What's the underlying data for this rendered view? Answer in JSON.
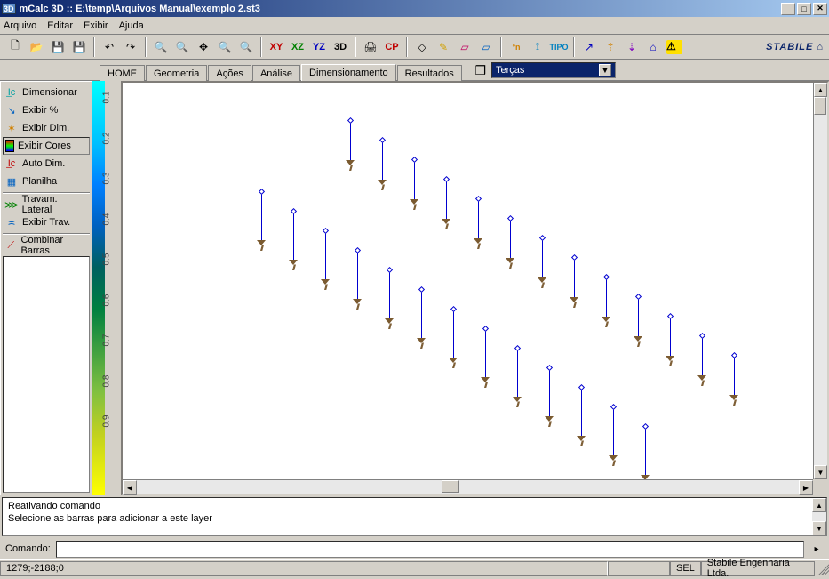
{
  "titlebar": {
    "app_icon_text": "3D",
    "title": "mCalc 3D :: E:\\temp\\Arquivos Manual\\exemplo 2.st3"
  },
  "menu": {
    "file": "Arquivo",
    "edit": "Editar",
    "view": "Exibir",
    "help": "Ajuda"
  },
  "toolbar": {
    "xy": "XY",
    "xz": "XZ",
    "yz": "YZ",
    "td": "3D",
    "cp": "CP",
    "on": "°n",
    "tipo": "TIPO",
    "stabile": "STABILE"
  },
  "tabs": {
    "home": "HOME",
    "geometria": "Geometria",
    "acoes": "Ações",
    "analise": "Análise",
    "dimensionamento": "Dimensionamento",
    "resultados": "Resultados"
  },
  "layer_dropdown": {
    "value": "Terças"
  },
  "sidebar": {
    "dimensionar": "Dimensionar",
    "exibir_pct": "Exibir %",
    "exibir_dim": "Exibir Dim.",
    "exibir_cores": "Exibir Cores",
    "auto_dim": "Auto Dim.",
    "planilha": "Planilha",
    "travam_lateral": "Travam. Lateral",
    "exibir_trav": "Exibir Trav.",
    "combinar_barras": "Combinar Barras"
  },
  "color_scale": {
    "labels": [
      "0.1",
      "0.2",
      "0.3",
      "0.4",
      "0.5",
      "0.6",
      "0.7",
      "0.8",
      "0.9"
    ]
  },
  "log": {
    "line1": "Reativando comando",
    "line2": "Selecione as barras para adicionar a este layer"
  },
  "command": {
    "label": "Comando:",
    "value": ""
  },
  "statusbar": {
    "coords": "1279;-2188;0",
    "sel": "SEL",
    "company": "Stabile Engenharia Ltda."
  },
  "chart_data": {
    "type": "scatter",
    "description": "3D structural model view showing two parallel rows of vertical bar elements (terças) with pinned-base supports, shown in oblique projection.",
    "rows": 2,
    "elements_per_row_approx": 13,
    "element_color": "#0000D0",
    "support_color": "#7A5A30",
    "background": "#FFFFFF"
  }
}
